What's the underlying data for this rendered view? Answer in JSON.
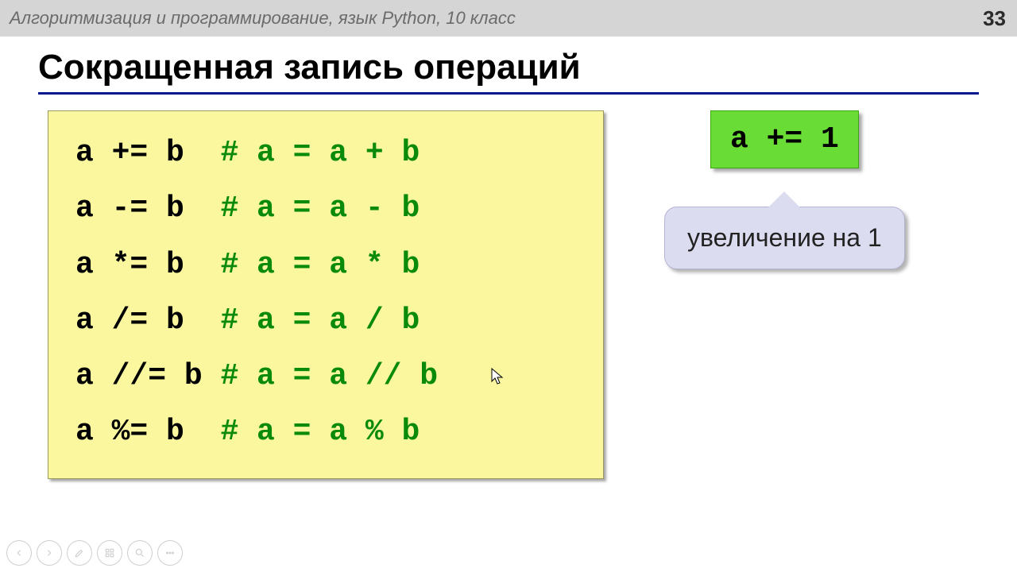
{
  "header": {
    "subject": "Алгоритмизация и программирование, язык Python, 10 класс",
    "page": "33"
  },
  "title": "Сокращенная запись операций",
  "code": [
    {
      "stmt": "a += b  ",
      "comment": "# a = a + b"
    },
    {
      "stmt": "a -= b  ",
      "comment": "# a = a - b"
    },
    {
      "stmt": "a *= b  ",
      "comment": "# a = a * b"
    },
    {
      "stmt": "a /= b  ",
      "comment": "# a = a / b"
    },
    {
      "stmt": "a //= b ",
      "comment": "# a = a // b"
    },
    {
      "stmt": "a %= b  ",
      "comment": "# a = a % b"
    }
  ],
  "increment": {
    "expr": "a += 1",
    "caption": "увеличение на 1"
  },
  "nav": {
    "prev": "prev",
    "next": "next",
    "pen": "pen",
    "grid": "grid",
    "zoom": "zoom",
    "more": "more"
  }
}
